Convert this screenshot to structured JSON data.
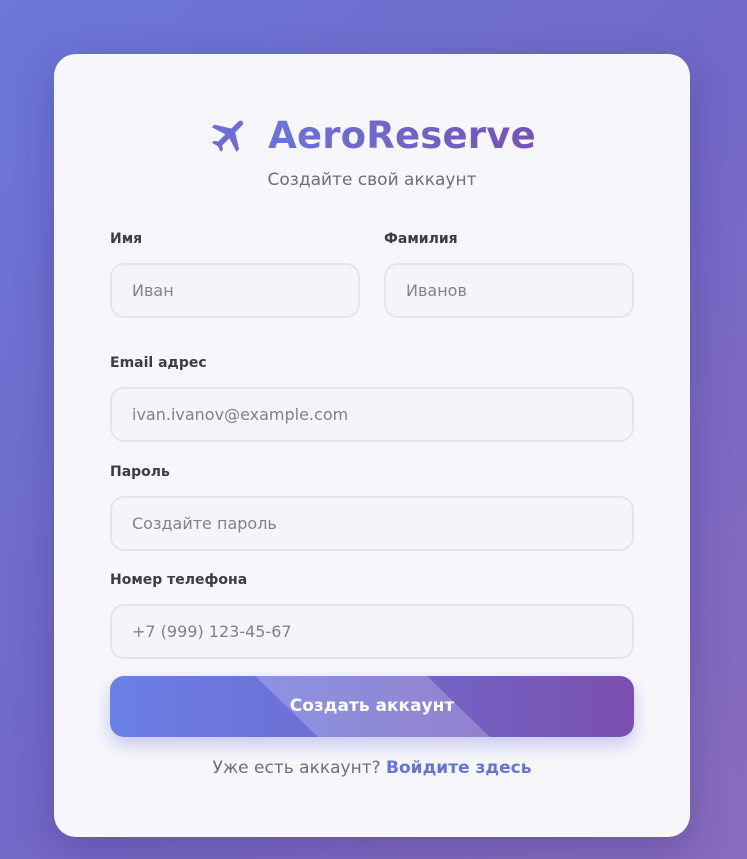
{
  "brand": {
    "name": "AeroReserve",
    "icon": "plane-icon",
    "subtitle": "Создайте свой аккаунт"
  },
  "form": {
    "first_name": {
      "label": "Имя",
      "placeholder": "Иван"
    },
    "last_name": {
      "label": "Фамилия",
      "placeholder": "Иванов"
    },
    "email": {
      "label": "Email адрес",
      "placeholder": "ivan.ivanov@example.com"
    },
    "password": {
      "label": "Пароль",
      "placeholder": "Создайте пароль"
    },
    "phone": {
      "label": "Номер телефона",
      "placeholder": "+7 (999) 123-45-67"
    },
    "submit_label": "Создать аккаунт"
  },
  "footer": {
    "prompt": "Уже есть аккаунт?",
    "link_label": "Войдите здесь"
  },
  "colors": {
    "accent": "#6a74dd",
    "accent_end": "#7753b6",
    "background_start": "#6b77d9",
    "background_end": "#8a6bbd"
  }
}
